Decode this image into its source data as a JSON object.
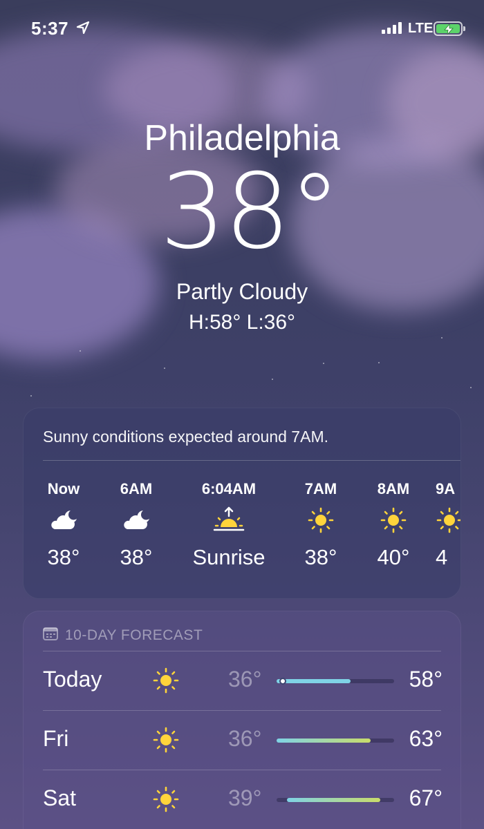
{
  "status_bar": {
    "time": "5:37",
    "network": "LTE",
    "icons": [
      "location-arrow-icon",
      "cellular-signal-icon",
      "battery-charging-icon"
    ]
  },
  "current": {
    "city": "Philadelphia",
    "temperature": "38°",
    "condition": "Partly Cloudy",
    "high_low": "H:58°  L:36°"
  },
  "hourly": {
    "summary": "Sunny conditions expected around 7AM.",
    "items": [
      {
        "time": "Now",
        "icon": "cloud-moon-icon",
        "value": "38°"
      },
      {
        "time": "6AM",
        "icon": "cloud-moon-icon",
        "value": "38°"
      },
      {
        "time": "6:04AM",
        "icon": "sunrise-icon",
        "value": "Sunrise"
      },
      {
        "time": "7AM",
        "icon": "sun-icon",
        "value": "38°"
      },
      {
        "time": "8AM",
        "icon": "sun-icon",
        "value": "40°"
      },
      {
        "time": "9A",
        "icon": "sun-icon",
        "value": "4"
      }
    ]
  },
  "ten_day": {
    "title": "10-DAY FORECAST",
    "icon": "calendar-icon",
    "days": [
      {
        "day": "Today",
        "icon": "sun-icon",
        "low": "36°",
        "high": "58°",
        "bar_start": 0.0,
        "bar_end": 0.63,
        "current_marker": 0.04
      },
      {
        "day": "Fri",
        "icon": "sun-icon",
        "low": "36°",
        "high": "63°",
        "bar_start": 0.0,
        "bar_end": 0.8
      },
      {
        "day": "Sat",
        "icon": "sun-icon",
        "low": "39°",
        "high": "67°",
        "bar_start": 0.09,
        "bar_end": 0.88
      }
    ]
  },
  "colors": {
    "sun": "#ffd43b",
    "range_cool": "#7fd3e6",
    "range_warm": "#c9dc6a",
    "battery": "#5cd36a"
  }
}
